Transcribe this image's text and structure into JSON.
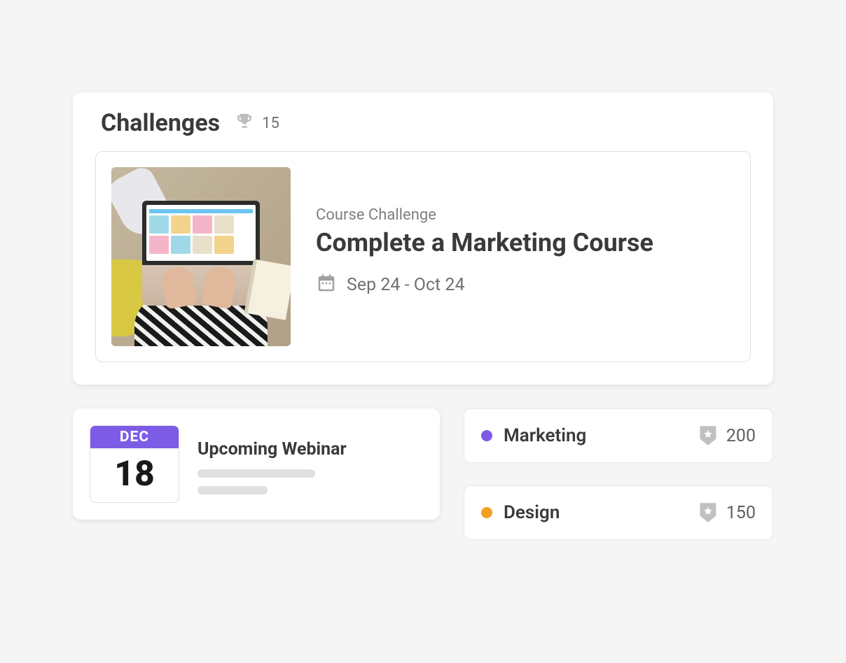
{
  "challenges": {
    "title": "Challenges",
    "trophy_count": "15",
    "item": {
      "subtitle": "Course Challenge",
      "title": "Complete a Marketing Course",
      "date_range": "Sep 24 - Oct 24"
    }
  },
  "webinar": {
    "month": "DEC",
    "day": "18",
    "title": "Upcoming Webinar"
  },
  "tags": [
    {
      "name": "Marketing",
      "points": "200",
      "color": "purple"
    },
    {
      "name": "Design",
      "points": "150",
      "color": "orange"
    }
  ]
}
